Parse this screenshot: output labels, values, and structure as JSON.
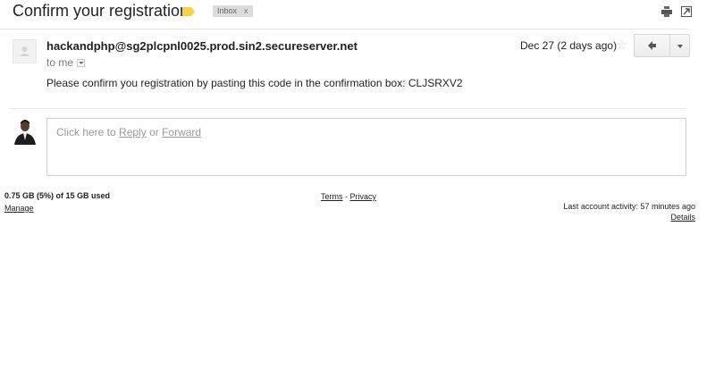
{
  "header": {
    "subject": "Confirm your registration",
    "label_color": "#f5d04a",
    "inbox_label": "Inbox",
    "inbox_remove": "x"
  },
  "message": {
    "sender": "hackandphp@sg2plcpnl0025.prod.sin2.secureserver.net",
    "to_line": "to me",
    "date": "Dec 27 (2 days ago)",
    "star": "☆",
    "body": "Please confirm you registration by pasting this code in the confirmation box: CLJSRXV2"
  },
  "reply": {
    "prefix": "Click here to",
    "reply_link": "Reply",
    "or": "or",
    "forward_link": "Forward"
  },
  "footer": {
    "quota": "0.75 GB (5%) of 15 GB used",
    "manage": "Manage",
    "terms": "Terms",
    "separator": "-",
    "privacy": "Privacy",
    "activity": "Last account activity: 57 minutes ago",
    "details": "Details"
  },
  "icons": {
    "label": "label-tag-icon",
    "print": "print-icon",
    "new_window": "new-window-icon",
    "star": "star-icon",
    "reply": "reply-arrow-icon",
    "more": "chevron-down-icon"
  }
}
